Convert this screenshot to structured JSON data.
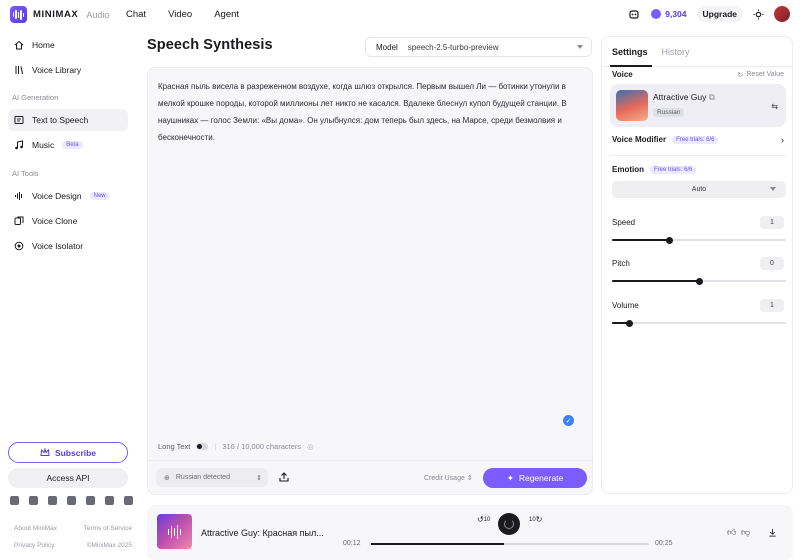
{
  "app": {
    "brand": "MINIMAX",
    "brand_sub": "Audio",
    "nav": [
      "Chat",
      "Video",
      "Agent"
    ],
    "credits": "9,304",
    "upgrade_label": "Upgrade"
  },
  "sidebar": {
    "items": [
      {
        "label": "Home",
        "icon": "home-icon"
      },
      {
        "label": "Voice Library",
        "icon": "library-icon"
      }
    ],
    "section_ai_generation": "AI Generation",
    "generation_items": [
      {
        "label": "Text to Speech",
        "icon": "text-speech-icon",
        "active": true
      },
      {
        "label": "Music",
        "icon": "music-icon",
        "badge": "Beta"
      }
    ],
    "section_ai_tools": "AI Tools",
    "tool_items": [
      {
        "label": "Voice Design",
        "icon": "voice-design-icon",
        "badge": "New"
      },
      {
        "label": "Voice Clone",
        "icon": "voice-clone-icon"
      },
      {
        "label": "Voice Isolator",
        "icon": "voice-isolator-icon"
      }
    ],
    "subscribe_label": "Subscribe",
    "api_label": "Access API",
    "footer": {
      "about": "About MiniMax",
      "terms": "Terms of Service",
      "privacy": "Privacy Policy",
      "copyright": "©MiniMax 2025"
    }
  },
  "main": {
    "title": "Speech Synthesis",
    "model_label": "Model",
    "model_value": "speech-2.5-turbo-preview",
    "text": "Красная пыль висела в разреженном воздухе, когда шлюз открылся. Первым вышел Ли — ботинки утонули в мелкой крошке породы, которой миллионы лет никто не касался. Вдалеке блеснул купол будущей станции. В наушниках — голос Земли: «Вы дома». Он улыбнулся: дом теперь был здесь, на Марсе, среди безмолвия и бесконечности.",
    "long_text_label": "Long Text",
    "char_count": "316 / 10,000 characters",
    "language_select": "Russian detected",
    "credit_usage": "Credit Usage",
    "regenerate_label": "Regenerate"
  },
  "settings": {
    "tabs": [
      "Settings",
      "History"
    ],
    "voice_label": "Voice",
    "reset_label": "Reset Value",
    "voice_name": "Attractive Guy",
    "voice_lang": "Russian",
    "modifier_label": "Voice Modifier",
    "modifier_trial": "Free trials: 6/6",
    "emotion_label": "Emotion",
    "emotion_trial": "Free trials: 6/6",
    "emotion_value": "Auto",
    "speed_label": "Speed",
    "speed_value": "1",
    "speed_level": 0.33,
    "pitch_label": "Pitch",
    "pitch_value": "0",
    "pitch_level": 0.5,
    "volume_label": "Volume",
    "volume_value": "1",
    "volume_level": 0.1
  },
  "player": {
    "title": "Attractive Guy: Красная пыл...",
    "rewind_label": "10",
    "forward_label": "10",
    "time_current": "00:12",
    "time_total": "00:25",
    "progress": 0.48
  }
}
